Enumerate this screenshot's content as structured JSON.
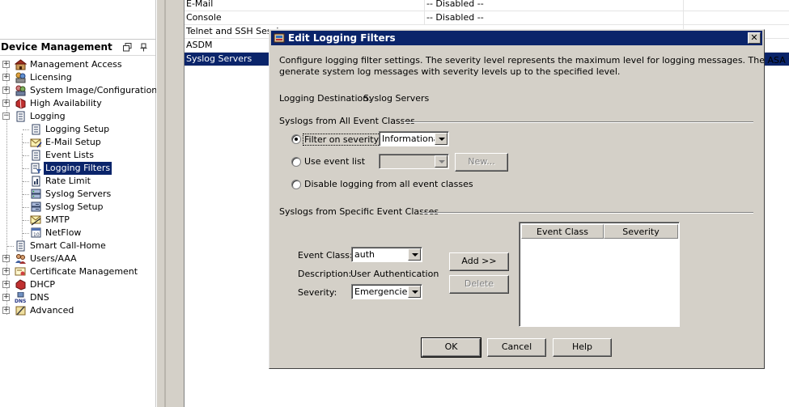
{
  "left_panel": {
    "title": "Device Management",
    "tree": [
      {
        "label": "Management Access",
        "icon": "management-access-icon"
      },
      {
        "label": "Licensing",
        "icon": "licensing-icon"
      },
      {
        "label": "System Image/Configuration",
        "icon": "system-image-icon"
      },
      {
        "label": "High Availability",
        "icon": "high-availability-icon"
      },
      {
        "label": "Logging",
        "icon": "logging-icon"
      },
      {
        "label": "Logging Setup",
        "icon": "logging-setup-icon"
      },
      {
        "label": "E-Mail Setup",
        "icon": "email-setup-icon"
      },
      {
        "label": "Event Lists",
        "icon": "event-lists-icon"
      },
      {
        "label": "Logging Filters",
        "icon": "logging-filters-icon"
      },
      {
        "label": "Rate Limit",
        "icon": "rate-limit-icon"
      },
      {
        "label": "Syslog Servers",
        "icon": "syslog-servers-icon"
      },
      {
        "label": "Syslog Setup",
        "icon": "syslog-setup-icon"
      },
      {
        "label": "SMTP",
        "icon": "smtp-icon"
      },
      {
        "label": "NetFlow",
        "icon": "netflow-icon"
      },
      {
        "label": "Smart Call-Home",
        "icon": "smart-call-home-icon"
      },
      {
        "label": "Users/AAA",
        "icon": "users-aaa-icon"
      },
      {
        "label": "Certificate Management",
        "icon": "certificate-management-icon"
      },
      {
        "label": "DHCP",
        "icon": "dhcp-icon"
      },
      {
        "label": "DNS",
        "icon": "dns-icon"
      },
      {
        "label": "Advanced",
        "icon": "advanced-icon"
      }
    ]
  },
  "table": {
    "rows": [
      {
        "destination": "E-Mail",
        "filter": "-- Disabled --"
      },
      {
        "destination": "Console",
        "filter": "-- Disabled --"
      },
      {
        "destination": "Telnet and SSH Sessions",
        "filter": ""
      },
      {
        "destination": "ASDM",
        "filter": ""
      },
      {
        "destination": "Syslog Servers",
        "filter": ""
      }
    ]
  },
  "dialog": {
    "title": "Edit Logging Filters",
    "description_line1": "Configure logging filter settings. The severity level represents the maximum level for logging messages. The ASA will",
    "description_line2": "generate system log messages with severity levels up to the specified level.",
    "destination_label": "Logging Destination:",
    "destination_value": "Syslog Servers",
    "all_classes": {
      "heading": "Syslogs from All Event Classes",
      "filter_on_severity": "Filter on severity",
      "severity_value": "Informational",
      "use_event_list": "Use event list",
      "event_list_value": "",
      "new_button": "New...",
      "disable_logging": "Disable logging from all event classes"
    },
    "specific_classes": {
      "heading": "Syslogs from Specific Event Classes",
      "event_class_label": "Event Class:",
      "event_class_value": "auth",
      "description_label": "Description:",
      "description_value": "User Authentication",
      "severity_label": "Severity:",
      "severity_value": "Emergencies",
      "add_button": "Add >>",
      "delete_button": "Delete",
      "table_headers": [
        "Event Class",
        "Severity"
      ]
    },
    "buttons": {
      "ok": "OK",
      "cancel": "Cancel",
      "help": "Help"
    }
  },
  "colors": {
    "selection": "#0a246a",
    "dialog_bg": "#d4d0c8"
  }
}
